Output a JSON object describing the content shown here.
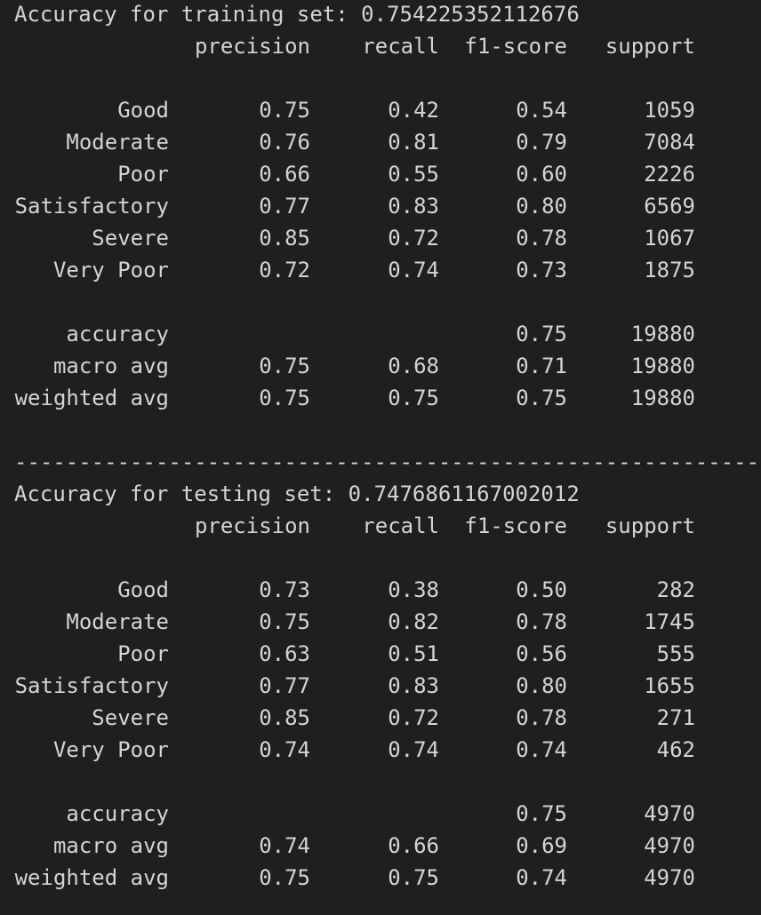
{
  "training": {
    "accuracy_line": "Accuracy for training set: 0.754225352112676",
    "headers": {
      "precision": "precision",
      "recall": "recall",
      "f1": "f1-score",
      "support": "support"
    },
    "classes": [
      {
        "label": "Good",
        "precision": "0.75",
        "recall": "0.42",
        "f1": "0.54",
        "support": "1059"
      },
      {
        "label": "Moderate",
        "precision": "0.76",
        "recall": "0.81",
        "f1": "0.79",
        "support": "7084"
      },
      {
        "label": "Poor",
        "precision": "0.66",
        "recall": "0.55",
        "f1": "0.60",
        "support": "2226"
      },
      {
        "label": "Satisfactory",
        "precision": "0.77",
        "recall": "0.83",
        "f1": "0.80",
        "support": "6569"
      },
      {
        "label": "Severe",
        "precision": "0.85",
        "recall": "0.72",
        "f1": "0.78",
        "support": "1067"
      },
      {
        "label": "Very Poor",
        "precision": "0.72",
        "recall": "0.74",
        "f1": "0.73",
        "support": "1875"
      }
    ],
    "summary": [
      {
        "label": "accuracy",
        "precision": "",
        "recall": "",
        "f1": "0.75",
        "support": "19880"
      },
      {
        "label": "macro avg",
        "precision": "0.75",
        "recall": "0.68",
        "f1": "0.71",
        "support": "19880"
      },
      {
        "label": "weighted avg",
        "precision": "0.75",
        "recall": "0.75",
        "f1": "0.75",
        "support": "19880"
      }
    ]
  },
  "separator": "------------------------------------------------------------",
  "testing": {
    "accuracy_line": "Accuracy for testing set: 0.7476861167002012",
    "headers": {
      "precision": "precision",
      "recall": "recall",
      "f1": "f1-score",
      "support": "support"
    },
    "classes": [
      {
        "label": "Good",
        "precision": "0.73",
        "recall": "0.38",
        "f1": "0.50",
        "support": "282"
      },
      {
        "label": "Moderate",
        "precision": "0.75",
        "recall": "0.82",
        "f1": "0.78",
        "support": "1745"
      },
      {
        "label": "Poor",
        "precision": "0.63",
        "recall": "0.51",
        "f1": "0.56",
        "support": "555"
      },
      {
        "label": "Satisfactory",
        "precision": "0.77",
        "recall": "0.83",
        "f1": "0.80",
        "support": "1655"
      },
      {
        "label": "Severe",
        "precision": "0.85",
        "recall": "0.72",
        "f1": "0.78",
        "support": "271"
      },
      {
        "label": "Very Poor",
        "precision": "0.74",
        "recall": "0.74",
        "f1": "0.74",
        "support": "462"
      }
    ],
    "summary": [
      {
        "label": "accuracy",
        "precision": "",
        "recall": "",
        "f1": "0.75",
        "support": "4970"
      },
      {
        "label": "macro avg",
        "precision": "0.74",
        "recall": "0.66",
        "f1": "0.69",
        "support": "4970"
      },
      {
        "label": "weighted avg",
        "precision": "0.75",
        "recall": "0.75",
        "f1": "0.74",
        "support": "4970"
      }
    ]
  },
  "colors": {
    "background": "#1f1f1f",
    "text": "#d4d4d4"
  }
}
